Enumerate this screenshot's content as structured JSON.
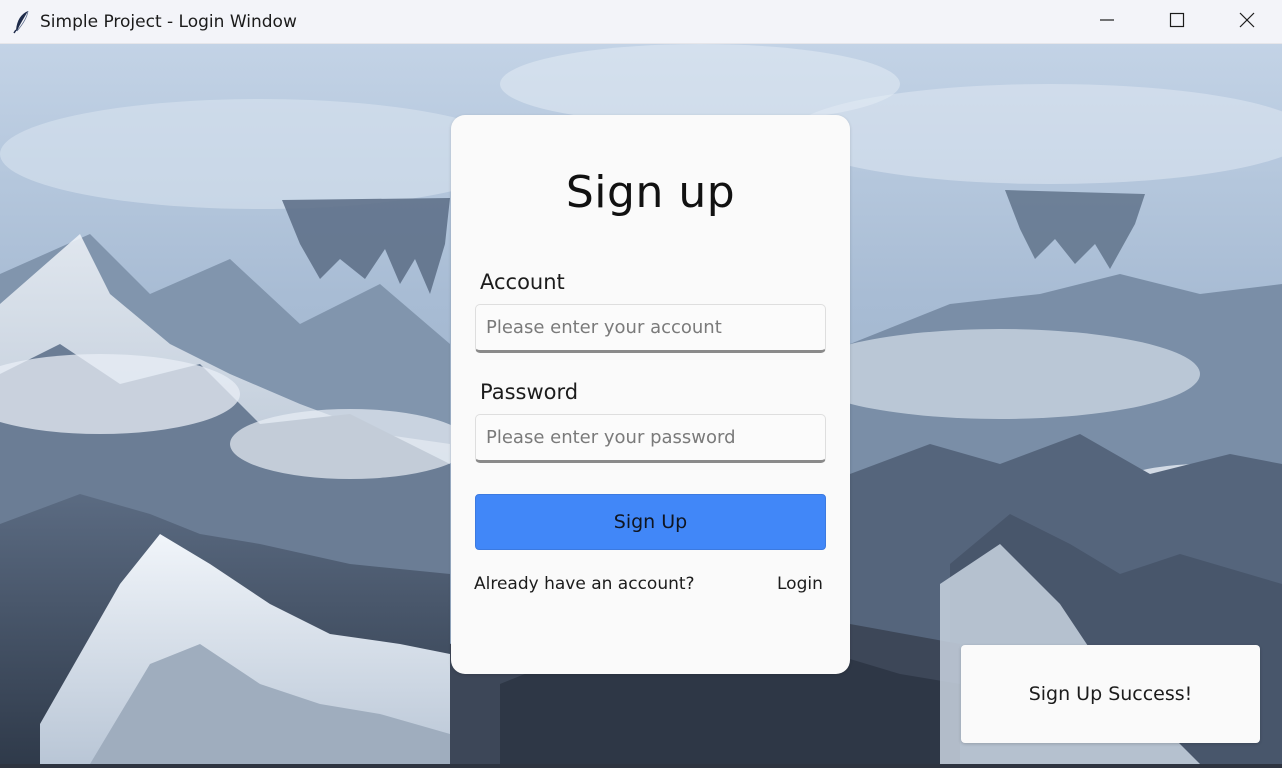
{
  "window": {
    "title": "Simple Project - Login Window",
    "app_icon": "feather-icon",
    "controls": [
      "minimize-icon",
      "maximize-icon",
      "close-icon"
    ]
  },
  "signup_form": {
    "title": "Sign up",
    "account_label": "Account",
    "account_placeholder": "Please enter your account",
    "account_value": "",
    "password_label": "Password",
    "password_placeholder": "Please enter your password",
    "password_value": "",
    "submit_label": "Sign Up",
    "already_text": "Already have an account?",
    "login_link": "Login"
  },
  "toast": {
    "message": "Sign Up Success!"
  },
  "colors": {
    "primary_button": "#4187f8",
    "card_background": "#fafafa",
    "titlebar": "#f3f4f9"
  }
}
